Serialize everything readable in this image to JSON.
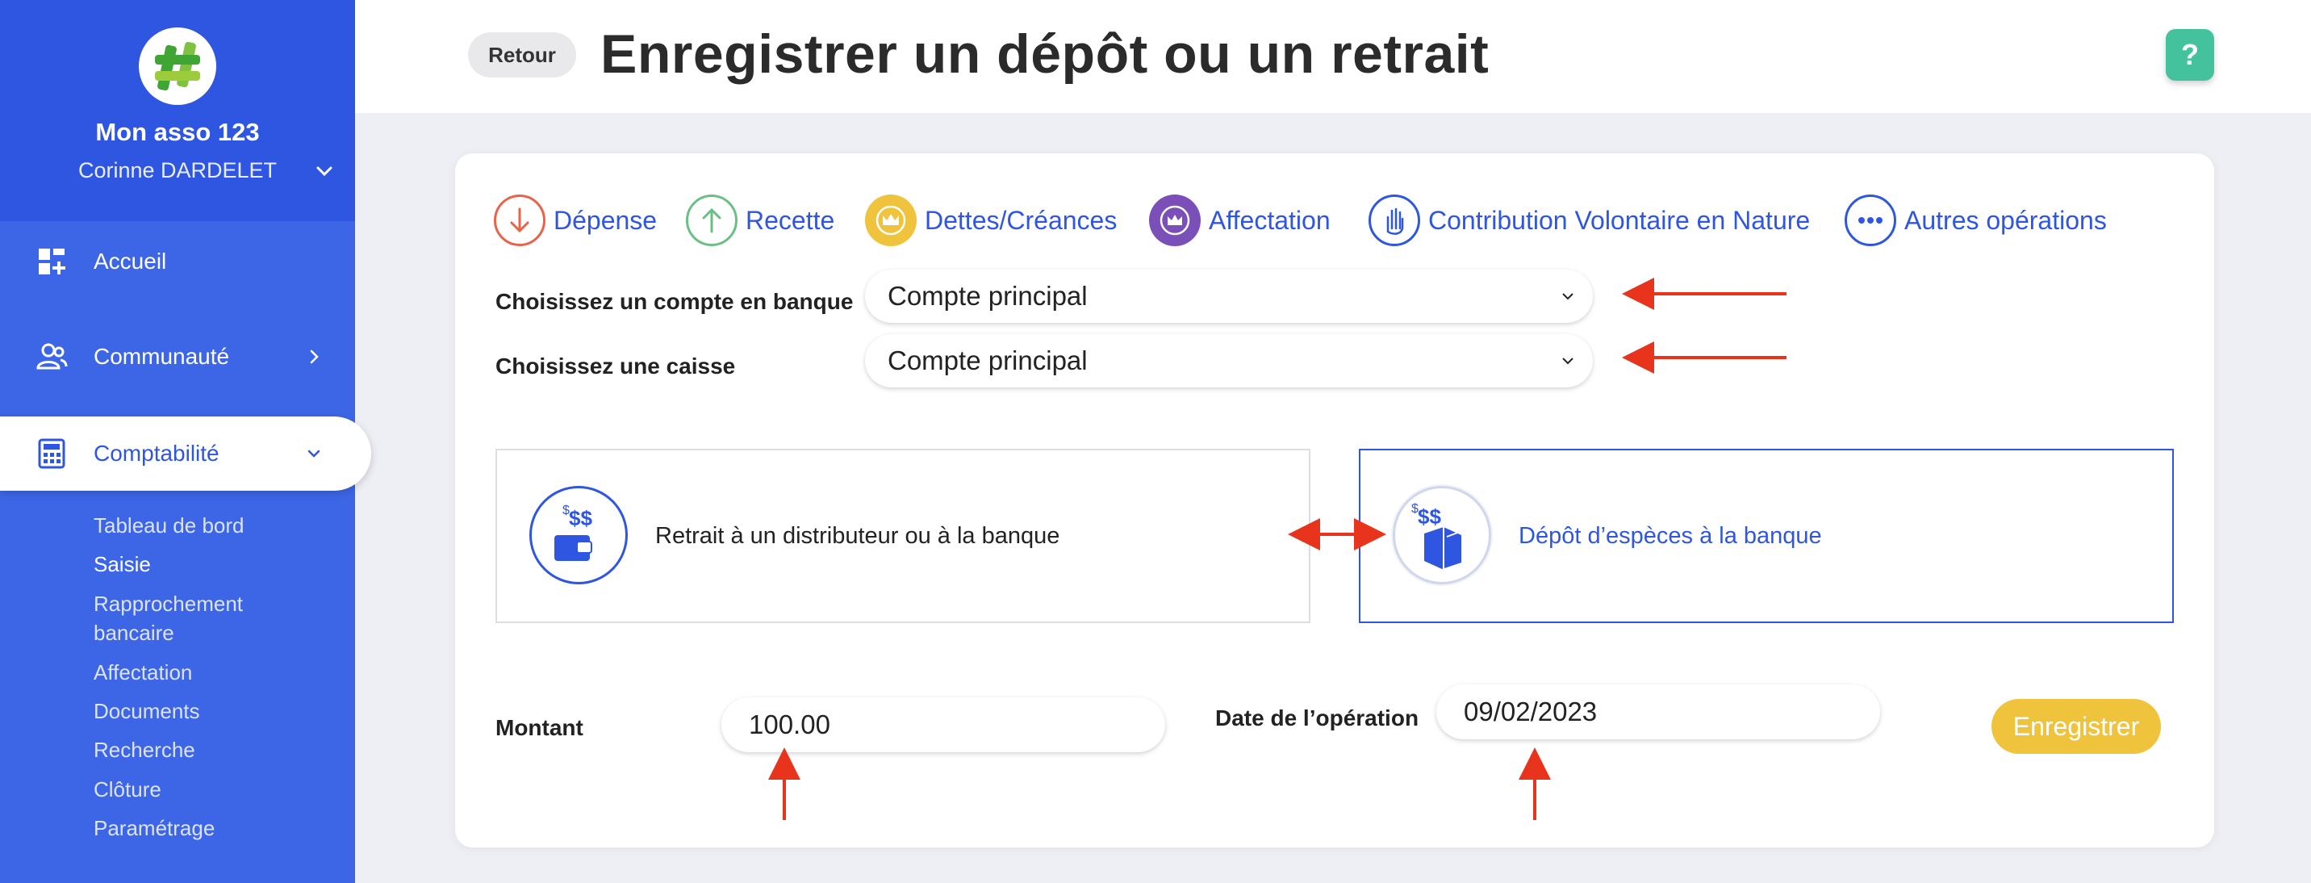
{
  "sidebar": {
    "org_name": "Mon asso 123",
    "user_name": "Corinne DARDELET",
    "nav": [
      {
        "label": "Accueil",
        "icon": "dashboard-icon"
      },
      {
        "label": "Communauté",
        "icon": "community-icon"
      },
      {
        "label": "Comptabilité",
        "icon": "calculator-icon"
      }
    ],
    "sub_items": [
      "Tableau de bord",
      "Saisie",
      "Rapprochement",
      "bancaire",
      "Affectation",
      "Documents",
      "Recherche",
      "Clôture",
      "Paramétrage"
    ],
    "active_sub": "Saisie",
    "colors": {
      "bg": "#3d66e6",
      "top": "#2f56e0"
    }
  },
  "header": {
    "back_label": "Retour",
    "title": "Enregistrer un dépôt ou un retrait",
    "help_label": "?"
  },
  "operation_types": [
    {
      "label": "Dépense",
      "icon": "arrow-down-icon",
      "color": "#e8634a"
    },
    {
      "label": "Recette",
      "icon": "arrow-up-icon",
      "color": "#6cbf84"
    },
    {
      "label": "Dettes/Créances",
      "icon": "crown-icon",
      "color": "#f0c33c"
    },
    {
      "label": "Affectation",
      "icon": "crown-arrows-icon",
      "color": "#7b4fb8"
    },
    {
      "label": "Contribution Volontaire en Nature",
      "icon": "hand-icon",
      "color": "#2f56e0"
    },
    {
      "label": "Autres opérations",
      "icon": "more-icon",
      "color": "#2f56e0"
    }
  ],
  "form": {
    "bank_label": "Choisissez un compte en banque",
    "bank_value": "Compte principal",
    "cash_label": "Choisissez une caisse",
    "cash_value": "Compte principal",
    "choices": [
      {
        "label": "Retrait à un distributeur ou à la banque",
        "icon": "wallet-withdraw-icon",
        "selected": false
      },
      {
        "label": "Dépôt d’espèces à la banque",
        "icon": "cash-deposit-icon",
        "selected": true
      }
    ],
    "amount_label": "Montant",
    "amount_value": "100.00",
    "date_label": "Date de l’opération",
    "date_value": "09/02/2023",
    "save_label": "Enregistrer"
  },
  "accent_color": "#2f56e0",
  "annotation_color": "#e8341c"
}
